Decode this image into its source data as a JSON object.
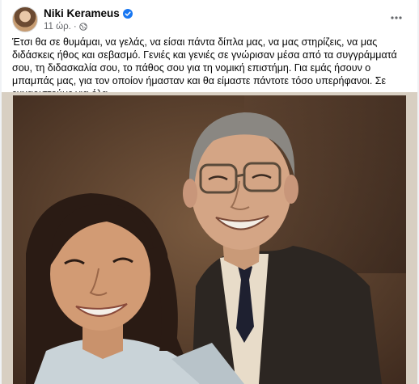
{
  "post": {
    "author": "Niki Kerameus",
    "timestamp": "11 ώρ.",
    "separator": "·",
    "text": "Έτσι θα σε θυμάμαι, να γελάς, να είσαι πάντα δίπλα μας, να μας στηρίζεις, να μας διδάσκεις ήθος και σεβασμό. Γενιές και γενιές σε γνώρισαν μέσα από τα συγγράμματά σου, τη διδασκαλία σου, το πάθος σου για τη νομική επιστήμη. Για εμάς ήσουν ο μπαμπάς μας, για τον οποίον ήμασταν και θα είμαστε πάντοτε τόσο υπερήφανοι. Σε ευχαριστούμε για όλα.",
    "icons": {
      "verified": "verified-badge-icon",
      "audience": "globe-icon",
      "more": "more-options-icon"
    }
  },
  "colors": {
    "verified": "#1877f2",
    "meta_text": "#65676b",
    "name_text": "#050505"
  }
}
